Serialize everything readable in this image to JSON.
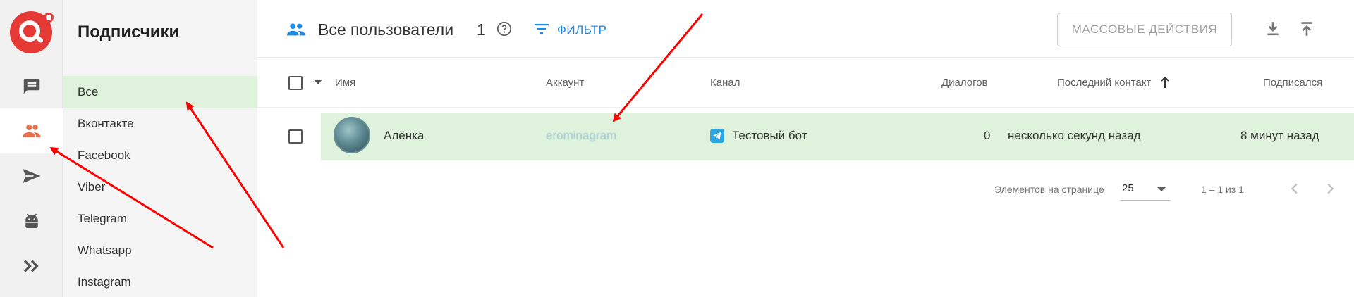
{
  "sidebar": {
    "title": "Подписчики",
    "items": [
      {
        "label": "Все"
      },
      {
        "label": "Вконтакте"
      },
      {
        "label": "Facebook"
      },
      {
        "label": "Viber"
      },
      {
        "label": "Telegram"
      },
      {
        "label": "Whatsapp"
      },
      {
        "label": "Instagram"
      }
    ]
  },
  "rail": {
    "icons": [
      "chat-icon",
      "users-icon",
      "send-icon",
      "android-icon",
      "double-chevron-icon"
    ],
    "active": "users-icon"
  },
  "toolbar": {
    "title": "Все пользователи",
    "count": "1",
    "filter_label": "ФИЛЬТР",
    "mass_actions_label": "МАССОВЫЕ ДЕЙСТВИЯ"
  },
  "table": {
    "columns": {
      "name": "Имя",
      "account": "Аккаунт",
      "channel": "Канал",
      "dialogs": "Диалогов",
      "last_contact": "Последний контакт",
      "subscribed": "Подписался"
    },
    "rows": [
      {
        "name": "Алёнка",
        "account": "erominagram",
        "channel": "Тестовый бот",
        "dialogs": "0",
        "last_contact": "несколько секунд назад",
        "subscribed": "8 минут назад"
      }
    ]
  },
  "paginator": {
    "items_per_page_label": "Элементов на странице",
    "page_size": "25",
    "range": "1 – 1 из 1"
  },
  "colors": {
    "accent": "#1e88e5",
    "brand": "#e53935",
    "active_bg": "#dff3dc",
    "rail_active_icon": "#e8704a",
    "annotation_arrow": "#ff0000"
  }
}
